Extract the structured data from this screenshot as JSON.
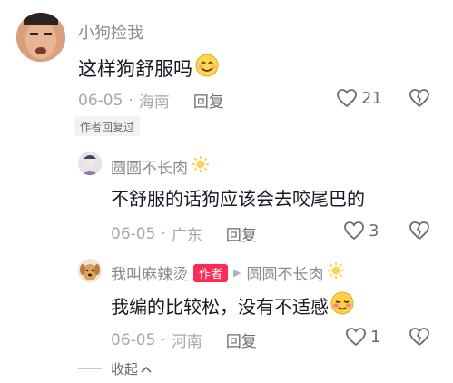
{
  "comment": {
    "username": "小狗捡我",
    "text": "这样狗舒服吗",
    "date": "06-05",
    "location": "海南",
    "reply_label": "回复",
    "likes": "21",
    "tag": "作者回复过"
  },
  "replies": [
    {
      "username": "圆圆不长肉",
      "text": "不舒服的话狗应该会去咬尾巴的",
      "date": "06-05",
      "location": "广东",
      "reply_label": "回复",
      "likes": "3"
    },
    {
      "username": "我叫麻辣烫",
      "author_badge": "作者",
      "reply_to": "圆圆不长肉",
      "text": "我编的比较松，没有不适感",
      "date": "06-05",
      "location": "河南",
      "reply_label": "回复",
      "likes": "1"
    }
  ],
  "collapse_label": "收起",
  "icons": [
    "emoji-smile-icon",
    "sun-icon",
    "emoji-shy-icon",
    "heart-icon",
    "broken-heart-icon",
    "chevron-up-icon",
    "triangle-right-icon"
  ],
  "colors": {
    "author_badge": "#fe2c55",
    "secondary_text": "#a6a7ab",
    "name_text": "#8a8b91"
  }
}
